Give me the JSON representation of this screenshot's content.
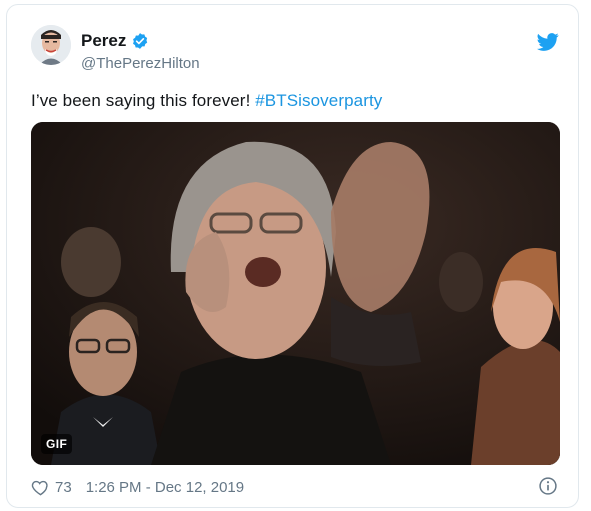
{
  "tweet": {
    "author": {
      "display_name": "Perez",
      "handle": "@ThePerezHilton",
      "verified": true
    },
    "text_main": "I’ve been saying this forever! ",
    "hashtag": "#BTSisoverparty",
    "media": {
      "type": "gif",
      "badge_label": "GIF"
    },
    "likes": "73",
    "timestamp": "1:26 PM - Dec 12, 2019"
  },
  "colors": {
    "accent": "#1b95e0",
    "twitter_blue": "#1da1f2",
    "text": "#14171a",
    "muted": "#657786",
    "border": "#e1e8ed"
  },
  "icons": {
    "verified": "verified-badge-icon",
    "brand": "twitter-bird-icon",
    "like": "heart-icon",
    "info": "info-icon"
  }
}
